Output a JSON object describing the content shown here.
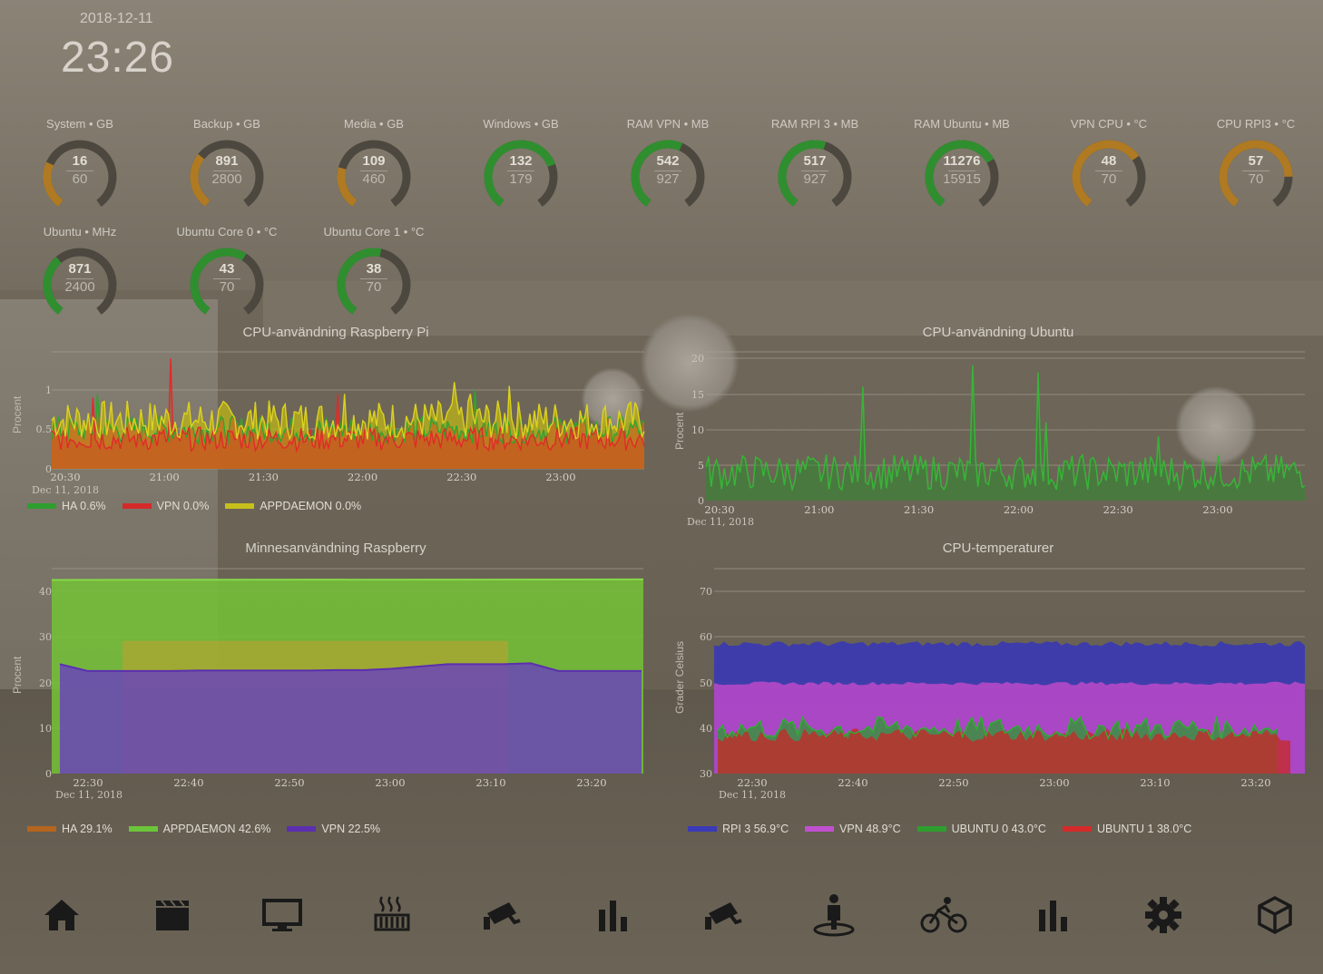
{
  "header": {
    "date": "2018-12-11",
    "time": "23:26"
  },
  "gauges": [
    {
      "title": "System • GB",
      "value": "16",
      "max": "60",
      "frac": 0.27,
      "color": "#b07a22"
    },
    {
      "title": "Backup • GB",
      "value": "891",
      "max": "2800",
      "frac": 0.32,
      "color": "#b07a22"
    },
    {
      "title": "Media • GB",
      "value": "109",
      "max": "460",
      "frac": 0.24,
      "color": "#b07a22"
    },
    {
      "title": "Windows • GB",
      "value": "132",
      "max": "179",
      "frac": 0.74,
      "color": "#2f8f2f"
    },
    {
      "title": "RAM VPN • MB",
      "value": "542",
      "max": "927",
      "frac": 0.58,
      "color": "#2f8f2f"
    },
    {
      "title": "RAM RPI 3 • MB",
      "value": "517",
      "max": "927",
      "frac": 0.56,
      "color": "#2f8f2f"
    },
    {
      "title": "RAM Ubuntu • MB",
      "value": "11276",
      "max": "15915",
      "frac": 0.71,
      "color": "#2f8f2f"
    },
    {
      "title": "VPN CPU • °C",
      "value": "48",
      "max": "70",
      "frac": 0.69,
      "color": "#b07a22"
    },
    {
      "title": "CPU RPI3 • °C",
      "value": "57",
      "max": "70",
      "frac": 0.81,
      "color": "#b07a22"
    },
    {
      "title": "Ubuntu • MHz",
      "value": "871",
      "max": "2400",
      "frac": 0.36,
      "color": "#2f8f2f"
    },
    {
      "title": "Ubuntu Core 0 • °C",
      "value": "43",
      "max": "70",
      "frac": 0.61,
      "color": "#2f8f2f"
    },
    {
      "title": "Ubuntu Core 1 • °C",
      "value": "38",
      "max": "70",
      "frac": 0.54,
      "color": "#2f8f2f"
    }
  ],
  "charts": {
    "rpi_cpu": {
      "title": "CPU-användning Raspberry Pi",
      "ylabel": "Procent",
      "yticks": [
        "1",
        "0.5",
        "0"
      ],
      "xticks": [
        "20:30",
        "21:00",
        "21:30",
        "22:00",
        "22:30",
        "23:00"
      ],
      "xsub": "Dec 11, 2018",
      "legend": [
        {
          "label": "HA 0.6%",
          "color": "#2e9e2e"
        },
        {
          "label": "VPN 0.0%",
          "color": "#d42a2a"
        },
        {
          "label": "APPDAEMON 0.0%",
          "color": "#c8c01a"
        }
      ]
    },
    "ubuntu_cpu": {
      "title": "CPU-användning Ubuntu",
      "ylabel": "Procent",
      "yticks": [
        "20",
        "15",
        "10",
        "5",
        "0"
      ],
      "xticks": [
        "20:30",
        "21:00",
        "21:30",
        "22:00",
        "22:30",
        "23:00"
      ],
      "xsub": "Dec 11, 2018"
    },
    "rpi_mem": {
      "title": "Minnesanvändning Raspberry",
      "ylabel": "Procent",
      "yticks": [
        "40",
        "30",
        "20",
        "10",
        "0"
      ],
      "xticks": [
        "22:30",
        "22:40",
        "22:50",
        "23:00",
        "23:10",
        "23:20"
      ],
      "xsub": "Dec 11, 2018",
      "legend": [
        {
          "label": "HA 29.1%",
          "color": "#b5651d"
        },
        {
          "label": "APPDAEMON 42.6%",
          "color": "#6cc43a"
        },
        {
          "label": "VPN 22.5%",
          "color": "#5b2fb0"
        }
      ]
    },
    "temps": {
      "title": "CPU-temperaturer",
      "ylabel": "Grader Celsius",
      "yticks": [
        "70",
        "60",
        "50",
        "40",
        "30"
      ],
      "xticks": [
        "22:30",
        "22:40",
        "22:50",
        "23:00",
        "23:10",
        "23:20"
      ],
      "xsub": "Dec 11, 2018",
      "legend": [
        {
          "label": "RPI 3 56.9°C",
          "color": "#3a3ab8"
        },
        {
          "label": "VPN 48.9°C",
          "color": "#c050d0"
        },
        {
          "label": "UBUNTU 0 43.0°C",
          "color": "#2e9e2e"
        },
        {
          "label": "UBUNTU 1 38.0°C",
          "color": "#d42a2a"
        }
      ]
    }
  },
  "chart_data": [
    {
      "type": "area",
      "title": "CPU-användning Raspberry Pi",
      "ylabel": "Procent",
      "ylim": [
        0,
        1
      ],
      "x": [
        "20:30",
        "21:00",
        "21:30",
        "22:00",
        "22:30",
        "23:00"
      ],
      "series": [
        {
          "name": "HA",
          "values": [
            0.5,
            0.6,
            0.5,
            0.6,
            0.8,
            0.6
          ]
        },
        {
          "name": "VPN",
          "values": [
            0.3,
            0.4,
            0.3,
            0.3,
            0.4,
            0.3
          ]
        },
        {
          "name": "APPDAEMON",
          "values": [
            0.6,
            0.7,
            0.6,
            0.7,
            0.7,
            0.6
          ]
        }
      ]
    },
    {
      "type": "area",
      "title": "CPU-användning Ubuntu",
      "ylabel": "Procent",
      "ylim": [
        0,
        20
      ],
      "x": [
        "20:30",
        "21:00",
        "21:30",
        "22:00",
        "22:30",
        "23:00"
      ],
      "series": [
        {
          "values": [
            4,
            5,
            9,
            7,
            5,
            5
          ]
        }
      ]
    },
    {
      "type": "area",
      "title": "Minnesanvändning Raspberry",
      "ylabel": "Procent",
      "ylim": [
        0,
        43
      ],
      "x": [
        "22:30",
        "22:40",
        "22:50",
        "23:00",
        "23:10",
        "23:20"
      ],
      "series": [
        {
          "name": "HA",
          "values": [
            29.1,
            29.1,
            29.1,
            29.1,
            29.1,
            29.1
          ]
        },
        {
          "name": "APPDAEMON",
          "values": [
            42.5,
            42.5,
            42.6,
            42.6,
            42.6,
            42.6
          ]
        },
        {
          "name": "VPN",
          "values": [
            22.5,
            22.5,
            22.6,
            22.7,
            24,
            22.5
          ]
        }
      ]
    },
    {
      "type": "area",
      "title": "CPU-temperaturer",
      "ylabel": "Grader Celsius",
      "ylim": [
        30,
        75
      ],
      "x": [
        "22:30",
        "22:40",
        "22:50",
        "23:00",
        "23:10",
        "23:20"
      ],
      "series": [
        {
          "name": "RPI 3",
          "values": [
            58.5,
            58.7,
            58.5,
            58.6,
            58.3,
            57
          ]
        },
        {
          "name": "VPN",
          "values": [
            50,
            49.8,
            49.8,
            49.8,
            49.6,
            48.9
          ]
        },
        {
          "name": "UBUNTU 0",
          "values": [
            40,
            42,
            40,
            41,
            40,
            43
          ]
        },
        {
          "name": "UBUNTU 1",
          "values": [
            38,
            39,
            38,
            39,
            38,
            38
          ]
        }
      ]
    }
  ],
  "nav": [
    {
      "icon": "home-icon",
      "name": "nav-home"
    },
    {
      "icon": "clapperboard-icon",
      "name": "nav-media"
    },
    {
      "icon": "monitor-icon",
      "name": "nav-tv"
    },
    {
      "icon": "heater-icon",
      "name": "nav-heating"
    },
    {
      "icon": "security-camera-icon",
      "name": "nav-camera-1"
    },
    {
      "icon": "bar-chart-icon",
      "name": "nav-stats-1"
    },
    {
      "icon": "security-camera-icon",
      "name": "nav-camera-2"
    },
    {
      "icon": "person-presence-icon",
      "name": "nav-presence"
    },
    {
      "icon": "bicycle-icon",
      "name": "nav-bike"
    },
    {
      "icon": "bar-chart-icon",
      "name": "nav-stats-2"
    },
    {
      "icon": "gear-icon",
      "name": "nav-settings"
    },
    {
      "icon": "cube-icon",
      "name": "nav-system"
    }
  ]
}
